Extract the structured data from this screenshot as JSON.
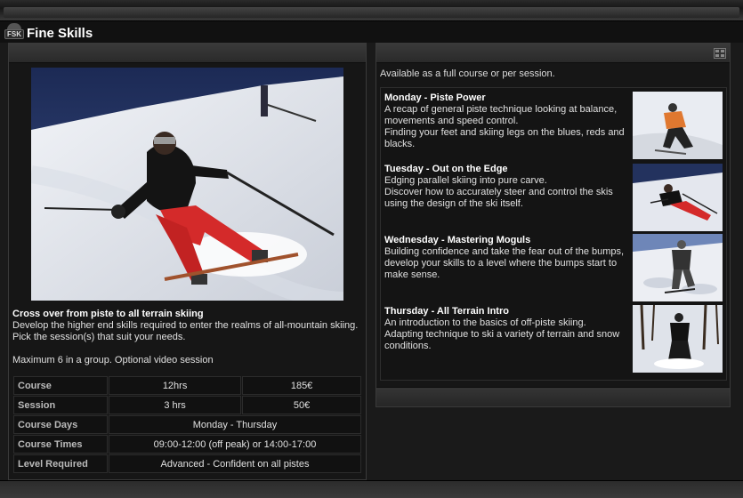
{
  "header": {
    "logo_text": "FSK",
    "title": "Fine Skills"
  },
  "left": {
    "intro_title": "Cross over from piste to all terrain skiing",
    "intro_text": "Develop the higher end skills required to enter the realms of all-mountain skiing. Pick the session(s) that suit your needs.",
    "note": "Maximum 6 in a group. Optional video session",
    "table": {
      "course": {
        "label": "Course",
        "duration": "12hrs",
        "price": "185€"
      },
      "session": {
        "label": "Session",
        "duration": "3 hrs",
        "price": "50€"
      },
      "days": {
        "label": "Course Days",
        "value": "Monday - Thursday"
      },
      "times": {
        "label": "Course Times",
        "value": "09:00-12:00 (off peak) or 14:00-17:00"
      },
      "level": {
        "label": "Level Required",
        "value": "Advanced - Confident on all pistes"
      }
    }
  },
  "right": {
    "availability": "Available as a full course or per session.",
    "days": [
      {
        "title": "Monday - Piste Power",
        "text": "A recap of general piste technique looking at balance, movements and speed control.",
        "text2": "Finding your feet and skiing legs on the blues, reds and blacks."
      },
      {
        "title": "Tuesday - Out on the Edge",
        "text": "Edging parallel skiing into pure carve.",
        "text2": "Discover how to accurately steer and control the skis using the design of the ski itself."
      },
      {
        "title": "Wednesday - Mastering Moguls",
        "text": "Building confidence and take the fear out of the bumps, develop your skills to a level where the bumps start to make sense.",
        "text2": ""
      },
      {
        "title": "Thursday - All Terrain Intro",
        "text": "An introduction to the basics of off-piste skiing.",
        "text2": "Adapting technique to ski a variety of terrain and snow conditions."
      }
    ]
  },
  "colors": {
    "background": "#1a1a1a",
    "panel": "#161616",
    "text": "#e0e0e0",
    "jacket_red": "#d42a2a"
  }
}
